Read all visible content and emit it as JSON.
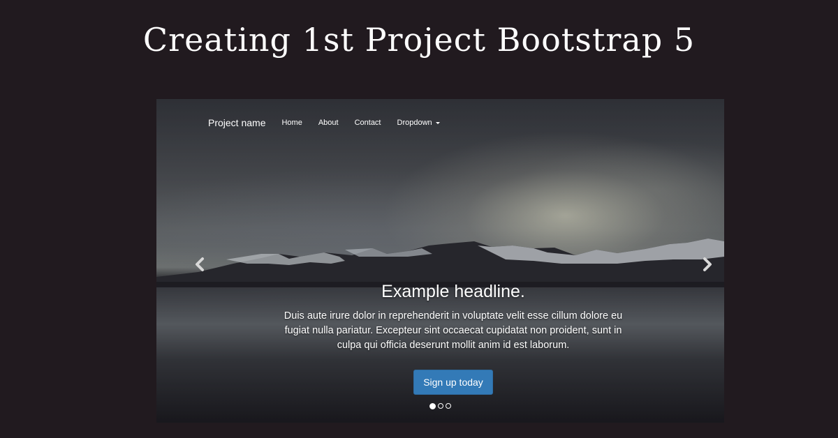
{
  "page": {
    "title": "Creating 1st Project Bootstrap 5"
  },
  "navbar": {
    "brand": "Project name",
    "links": [
      {
        "label": "Home"
      },
      {
        "label": "About"
      },
      {
        "label": "Contact"
      },
      {
        "label": "Dropdown",
        "icon": "caret-down-icon"
      }
    ]
  },
  "carousel": {
    "prev_icon": "chevron-left-icon",
    "next_icon": "chevron-right-icon",
    "active_slide": 1,
    "slide_count": 3,
    "caption": {
      "headline": "Example headline.",
      "body": "Duis aute irure dolor in reprehenderit in voluptate velit esse cillum dolore eu fugiat nulla pariatur. Excepteur sint occaecat cupidatat non proident, sunt in culpa qui officia deserunt mollit anim id est laborum.",
      "button": "Sign up today"
    }
  },
  "colors": {
    "background": "#211a1f",
    "primary_button": "#337ab7",
    "text": "#ffffff"
  }
}
